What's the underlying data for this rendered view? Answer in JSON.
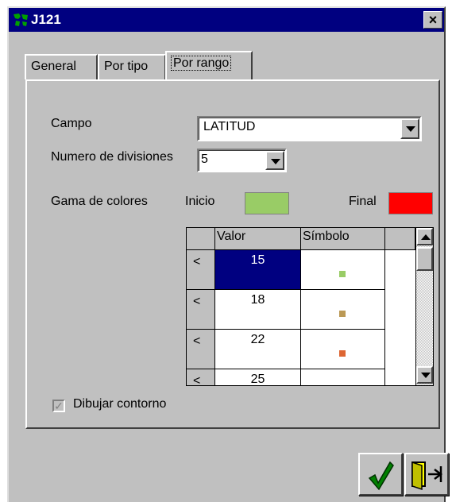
{
  "window": {
    "title": "J121",
    "close_label": "×"
  },
  "tabs": [
    {
      "label": "General",
      "active": false
    },
    {
      "label": "Por tipo",
      "active": false
    },
    {
      "label": "Por rango",
      "active": true
    }
  ],
  "form": {
    "campo_label": "Campo",
    "campo_value": "LATITUD",
    "divisiones_label": "Numero de divisiones",
    "divisiones_value": "5",
    "gama_label": "Gama de colores",
    "inicio_label": "Inicio",
    "final_label": "Final",
    "colors": {
      "inicio": "#99CC66",
      "final": "#FF0000"
    }
  },
  "table": {
    "headers": {
      "indicator": "",
      "valor": "Valor",
      "simbolo": "Símbolo"
    },
    "rows": [
      {
        "op": "<",
        "valor": "15",
        "color": "#99CC66",
        "selected": true
      },
      {
        "op": "<",
        "valor": "18",
        "color": "#BB9955",
        "selected": false
      },
      {
        "op": "<",
        "valor": "22",
        "color": "#DD6633",
        "selected": false
      },
      {
        "op": "<",
        "valor": "25",
        "color": "#FF3311",
        "selected": false
      }
    ]
  },
  "options": {
    "dibujar_contorno_label": "Dibujar contorno",
    "dibujar_contorno_checked": true
  },
  "buttons": {
    "ok_icon": "checkmark-icon",
    "exit_icon": "exit-door-icon"
  }
}
